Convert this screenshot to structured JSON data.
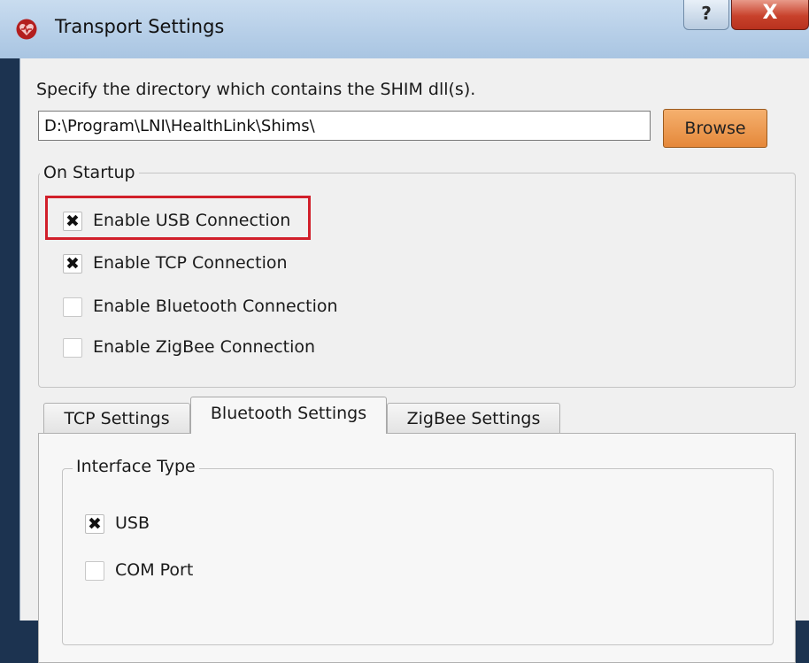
{
  "window": {
    "title": "Transport Settings",
    "app_icon": "heart-icon",
    "help_label": "?",
    "close_label": "X"
  },
  "directory": {
    "instruction": "Specify the directory which contains the SHIM dll(s).",
    "path_value": "D:\\Program\\LNI\\HealthLink\\Shims\\",
    "browse_label": "Browse"
  },
  "startup": {
    "title": "On Startup",
    "options": [
      {
        "label": "Enable USB Connection",
        "checked": true
      },
      {
        "label": "Enable TCP Connection",
        "checked": true
      },
      {
        "label": "Enable Bluetooth Connection",
        "checked": false
      },
      {
        "label": "Enable ZigBee Connection",
        "checked": false
      }
    ]
  },
  "tabs": [
    {
      "label": "TCP Settings",
      "active": false
    },
    {
      "label": "Bluetooth Settings",
      "active": true
    },
    {
      "label": "ZigBee Settings",
      "active": false
    }
  ],
  "bluetooth": {
    "interface_title": "Interface Type",
    "options": [
      {
        "label": "USB",
        "checked": true
      },
      {
        "label": "COM Port",
        "checked": false
      }
    ]
  },
  "colors": {
    "highlight": "#d11f2a",
    "browse_button": "#e5883a",
    "close_button": "#c8412b"
  }
}
